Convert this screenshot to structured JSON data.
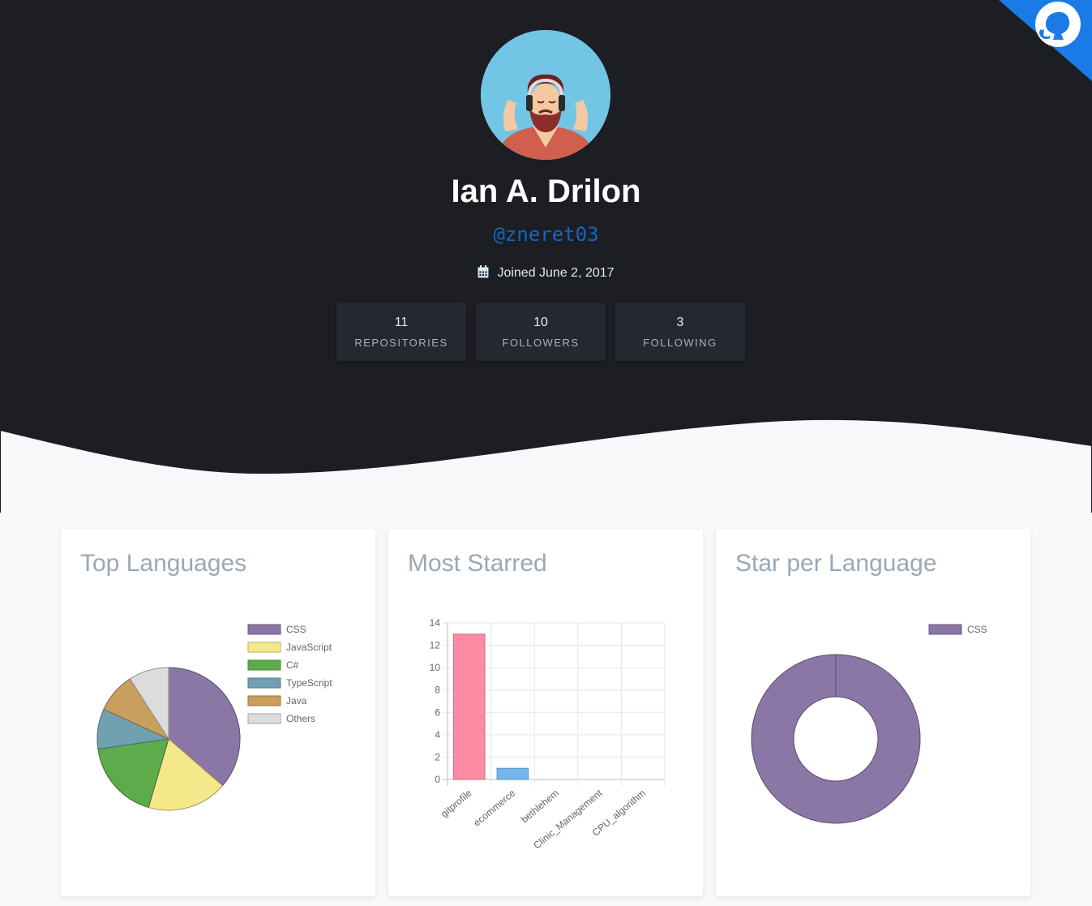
{
  "profile": {
    "name": "Ian A. Drilon",
    "handle": "@zneret03",
    "joined": "Joined June 2, 2017"
  },
  "stats": [
    {
      "value": "11",
      "label": "REPOSITORIES"
    },
    {
      "value": "10",
      "label": "FOLLOWERS"
    },
    {
      "value": "3",
      "label": "FOLLOWING"
    }
  ],
  "icons": {
    "corner": "github-octocat-icon",
    "joined": "calendar-icon"
  },
  "colors": {
    "hero_bg": "#1c1e24",
    "page_bg": "#f6f8fa",
    "corner_blue": "#1a7be6",
    "handle": "#1565c0"
  },
  "cards": {
    "top_languages": "Top Languages",
    "most_starred": "Most Starred",
    "star_per_language": "Star per Language"
  },
  "chart_data": [
    {
      "type": "pie",
      "labels": [
        "CSS",
        "JavaScript",
        "C#",
        "TypeScript",
        "Java",
        "Others"
      ],
      "values": [
        4,
        2,
        2,
        1,
        1,
        1
      ],
      "colors": [
        "#8a77a6",
        "#f5e88a",
        "#5dab4a",
        "#6fa1b0",
        "#c99f5d",
        "#dcdcdc"
      ],
      "legend": "top-right"
    },
    {
      "type": "bar",
      "categories": [
        "gitprofile",
        "ecommerce",
        "bethlehem",
        "Clinic_Management",
        "CPU_algorithm"
      ],
      "values": [
        13,
        1,
        0,
        0,
        0
      ],
      "colors": [
        "#ff8ba3",
        "#74b7ec",
        "#ffce56",
        "#4bc0c0",
        "#9966ff"
      ],
      "yticks": [
        "0",
        "2",
        "4",
        "6",
        "8",
        "10",
        "12",
        "14"
      ],
      "ylim": [
        0,
        14
      ],
      "grid": true
    },
    {
      "type": "pie",
      "labels": [
        "CSS"
      ],
      "values": [
        13
      ],
      "colors": [
        "#8a77a6"
      ],
      "legend": "top-right"
    }
  ]
}
